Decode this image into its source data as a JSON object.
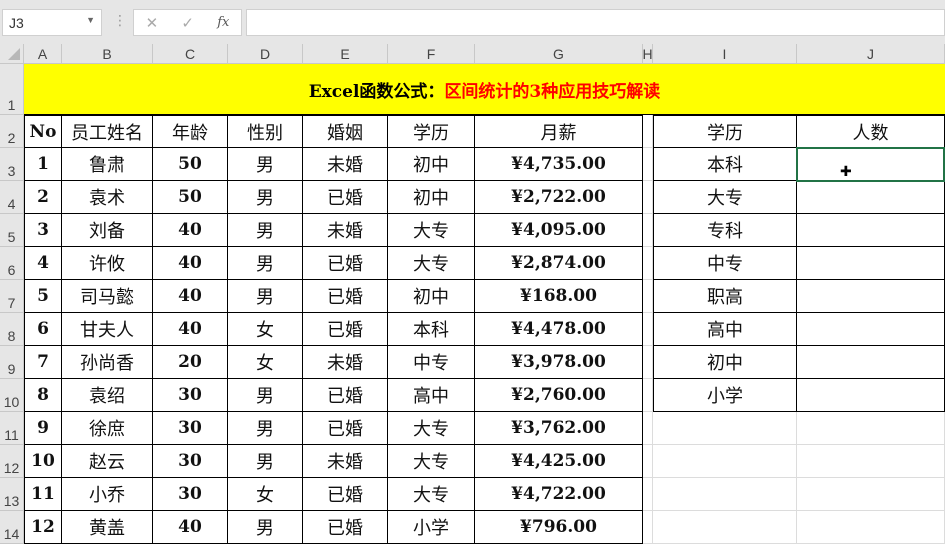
{
  "formula_bar": {
    "name_box": "J3",
    "cancel_icon": "✕",
    "enter_icon": "✓",
    "fx_label": "fx",
    "formula": ""
  },
  "columns": [
    "A",
    "B",
    "C",
    "D",
    "E",
    "F",
    "G",
    "H",
    "I",
    "J"
  ],
  "rows": [
    "1",
    "2",
    "3",
    "4",
    "5",
    "6",
    "7",
    "8",
    "9",
    "10",
    "11",
    "12",
    "13",
    "14"
  ],
  "title": {
    "black": "Excel函数公式：",
    "red": "区间统计的3种应用技巧解读"
  },
  "table": {
    "headers": [
      "No",
      "员工姓名",
      "年龄",
      "性别",
      "婚姻",
      "学历",
      "月薪"
    ],
    "rows": [
      [
        "1",
        "鲁肃",
        "50",
        "男",
        "未婚",
        "初中",
        "¥4,735.00"
      ],
      [
        "2",
        "袁术",
        "50",
        "男",
        "已婚",
        "初中",
        "¥2,722.00"
      ],
      [
        "3",
        "刘备",
        "40",
        "男",
        "未婚",
        "大专",
        "¥4,095.00"
      ],
      [
        "4",
        "许攸",
        "40",
        "男",
        "已婚",
        "大专",
        "¥2,874.00"
      ],
      [
        "5",
        "司马懿",
        "40",
        "男",
        "已婚",
        "初中",
        "¥168.00"
      ],
      [
        "6",
        "甘夫人",
        "40",
        "女",
        "已婚",
        "本科",
        "¥4,478.00"
      ],
      [
        "7",
        "孙尚香",
        "20",
        "女",
        "未婚",
        "中专",
        "¥3,978.00"
      ],
      [
        "8",
        "袁绍",
        "30",
        "男",
        "已婚",
        "高中",
        "¥2,760.00"
      ],
      [
        "9",
        "徐庶",
        "30",
        "男",
        "已婚",
        "大专",
        "¥3,762.00"
      ],
      [
        "10",
        "赵云",
        "30",
        "男",
        "未婚",
        "大专",
        "¥4,425.00"
      ],
      [
        "11",
        "小乔",
        "30",
        "女",
        "已婚",
        "大专",
        "¥4,722.00"
      ],
      [
        "12",
        "黄盖",
        "40",
        "男",
        "已婚",
        "小学",
        "¥796.00"
      ]
    ]
  },
  "summary": {
    "headers": [
      "学历",
      "人数"
    ],
    "rows": [
      [
        "本科",
        ""
      ],
      [
        "大专",
        ""
      ],
      [
        "专科",
        ""
      ],
      [
        "中专",
        ""
      ],
      [
        "职高",
        ""
      ],
      [
        "高中",
        ""
      ],
      [
        "初中",
        ""
      ],
      [
        "小学",
        ""
      ]
    ]
  },
  "selected_cell": "J3"
}
